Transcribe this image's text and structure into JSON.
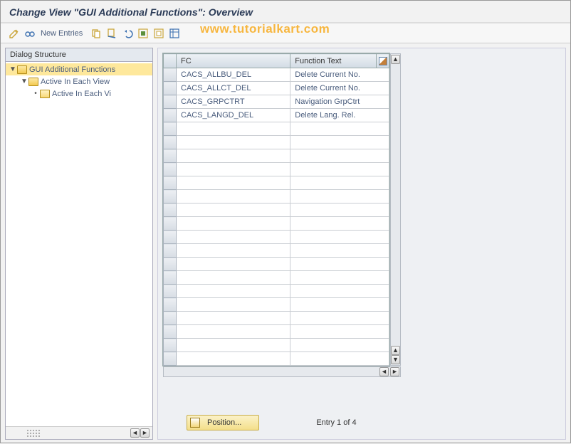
{
  "title": "Change View \"GUI Additional Functions\": Overview",
  "watermark": "www.tutorialkart.com",
  "toolbar": {
    "new_entries": "New Entries"
  },
  "tree": {
    "header": "Dialog Structure",
    "items": [
      {
        "label": "GUI Additional Functions",
        "level": 0,
        "open": true,
        "selected": true
      },
      {
        "label": "Active In Each View",
        "level": 1,
        "open": true,
        "selected": false
      },
      {
        "label": "Active In Each Vi",
        "level": 2,
        "open": false,
        "selected": false
      }
    ]
  },
  "table": {
    "headers": {
      "fc": "FC",
      "ftext": "Function Text"
    },
    "rows": [
      {
        "fc": "CACS_ALLBU_DEL",
        "ftext": "Delete Current No."
      },
      {
        "fc": "CACS_ALLCT_DEL",
        "ftext": "Delete Current No."
      },
      {
        "fc": "CACS_GRPCTRT",
        "ftext": "Navigation GrpCtrt"
      },
      {
        "fc": "CACS_LANGD_DEL",
        "ftext": "Delete Lang. Rel."
      }
    ],
    "empty_rows": 18
  },
  "footer": {
    "position_label": "Position...",
    "status": "Entry 1 of 4"
  }
}
